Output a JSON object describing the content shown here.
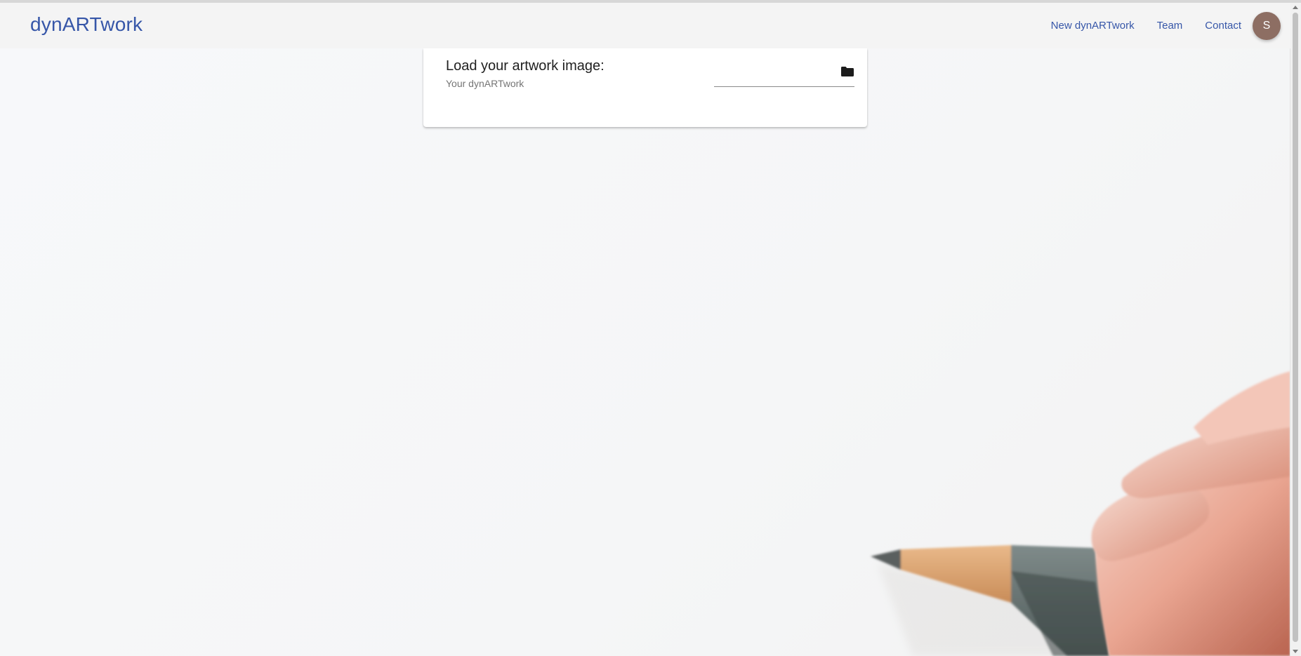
{
  "navbar": {
    "brand": "dynARTwork",
    "links": [
      "New dynARTwork",
      "Team",
      "Contact"
    ],
    "avatar_initial": "S"
  },
  "card": {
    "title": "Load your artwork image:",
    "subtitle": "Your dynARTwork",
    "file_icon": "folder-icon"
  },
  "colors": {
    "brand": "#3656a8",
    "avatar": "#8d6e63",
    "background": "#f6f7f8"
  }
}
